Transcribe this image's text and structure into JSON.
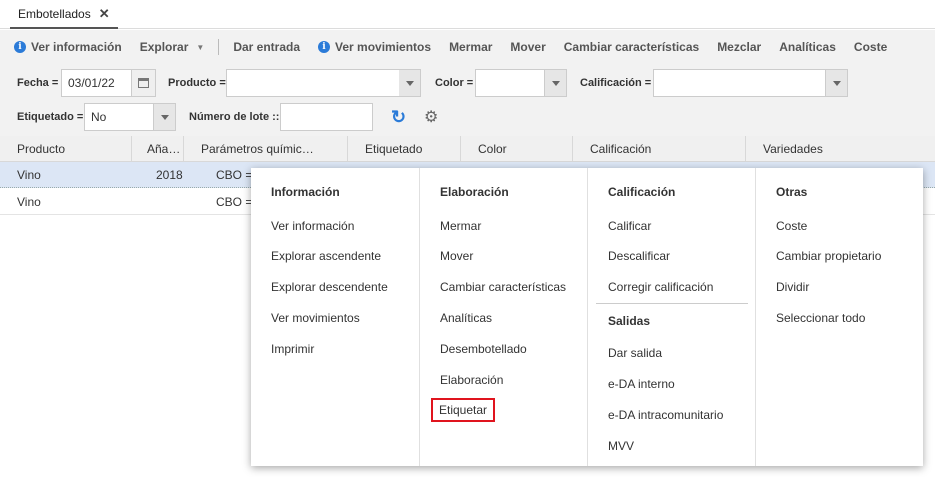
{
  "tab": {
    "label": "Embotellados",
    "close": "✕"
  },
  "toolbar": {
    "ver_informacion": "Ver información",
    "explorar": "Explorar",
    "dar_entrada": "Dar entrada",
    "ver_movimientos": "Ver movimientos",
    "mermar": "Mermar",
    "mover": "Mover",
    "cambiar_caracteristicas": "Cambiar características",
    "mezclar": "Mezclar",
    "analiticas": "Analíticas",
    "coste": "Coste"
  },
  "filters": {
    "fecha_label": "Fecha =",
    "fecha_value": "03/01/22",
    "producto_label": "Producto =",
    "producto_value": "",
    "color_label": "Color =",
    "color_value": "",
    "calificacion_label": "Calificación =",
    "calificacion_value": "",
    "etiquetado_label": "Etiquetado =",
    "etiquetado_value": "No",
    "lote_label": "Número de lote ::",
    "lote_value": ""
  },
  "grid": {
    "columns": [
      "Producto",
      "Aña…",
      "Parámetros químic…",
      "Etiquetado",
      "Color",
      "Calificación",
      "Variedades"
    ],
    "rows": [
      {
        "producto": "Vino",
        "anada": "2018",
        "parametros": "CBO ="
      },
      {
        "producto": "Vino",
        "anada": "",
        "parametros": "CBO ="
      }
    ]
  },
  "menu": {
    "informacion": {
      "header": "Información",
      "items": [
        "Ver información",
        "Explorar ascendente",
        "Explorar descendente",
        "Ver movimientos",
        "Imprimir"
      ]
    },
    "elaboracion": {
      "header": "Elaboración",
      "items": [
        "Mermar",
        "Mover",
        "Cambiar características",
        "Analíticas",
        "Desembotellado",
        "Elaboración",
        "Etiquetar"
      ]
    },
    "calificacion": {
      "header": "Calificación",
      "items": [
        "Calificar",
        "Descalificar",
        "Corregir calificación"
      ]
    },
    "salidas": {
      "header": "Salidas",
      "items": [
        "Dar salida",
        "e-DA interno",
        "e-DA intracomunitario",
        "MVV"
      ]
    },
    "otras": {
      "header": "Otras",
      "items": [
        "Coste",
        "Cambiar propietario",
        "Dividir",
        "Seleccionar todo"
      ]
    }
  },
  "colors": {
    "accent": "#2b7bd8",
    "highlight_box": "#e0141e",
    "selected_row": "#dce6f5"
  }
}
